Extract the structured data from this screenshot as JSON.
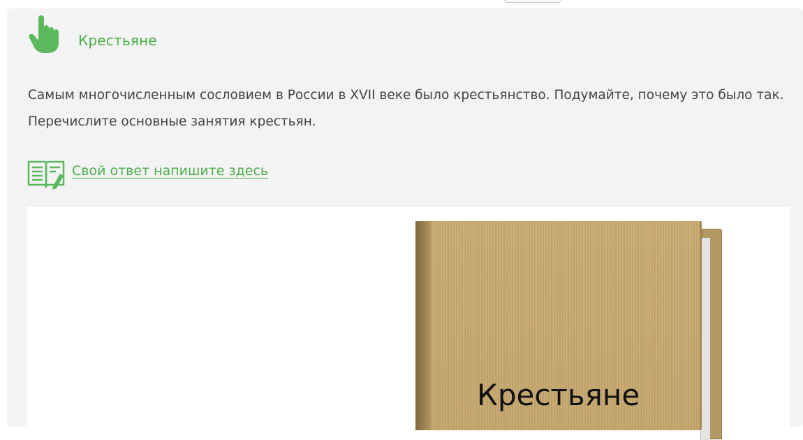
{
  "card": {
    "title": "Крестьяне",
    "question": "Самым многочисленным сословием в России в XVII веке было крестьянство. Подумайте, почему это было так. Перечислите основные занятия крестьян.",
    "answer_link": "Свой ответ напишите здесь"
  },
  "image": {
    "folder_label": "Крестьяне"
  },
  "colors": {
    "accent_green": "#4cae4c",
    "card_background": "#f3f3f3",
    "text": "#444444",
    "folder": "#c4a66c"
  },
  "icons": {
    "header_icon": "pointing-hand-icon",
    "answer_icon": "book-pencil-icon"
  }
}
